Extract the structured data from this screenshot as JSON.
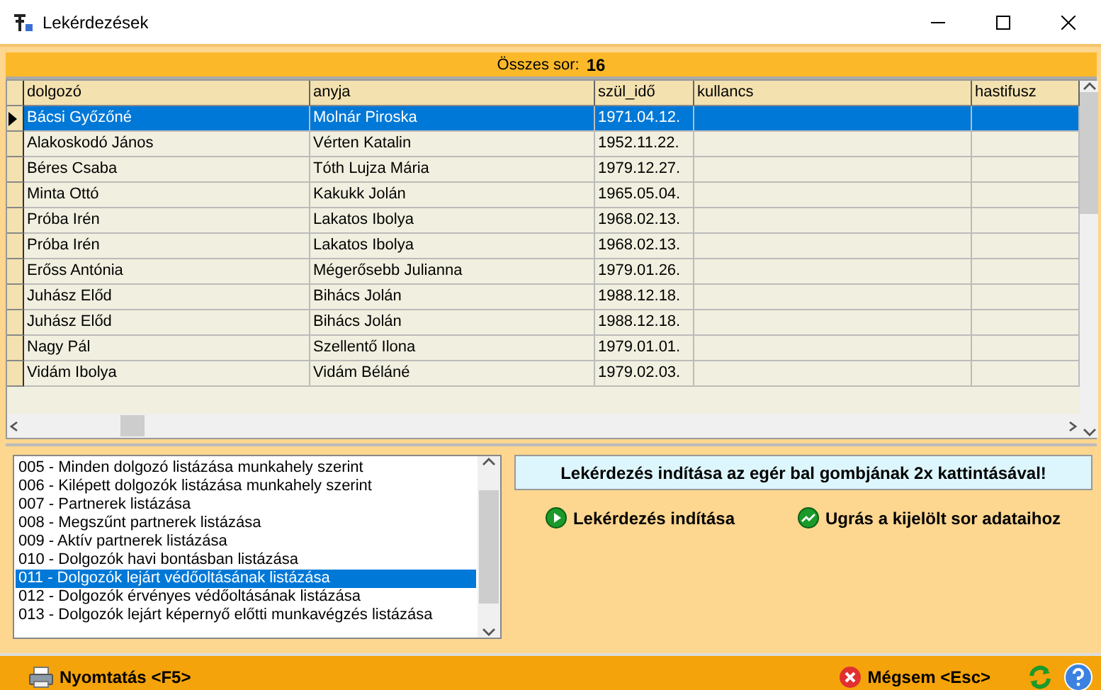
{
  "window": {
    "title": "Lekérdezések"
  },
  "summary": {
    "label": "Összes sor:",
    "value": "16"
  },
  "table": {
    "columns": [
      "dolgozó",
      "anyja",
      "szül_idő",
      "kullancs",
      "hastifusz"
    ],
    "rows": [
      {
        "cells": [
          "Bácsi Győzőné",
          "Molnár Piroska",
          "1971.04.12.",
          "",
          ""
        ],
        "selected": true
      },
      {
        "cells": [
          "Alakoskodó János",
          "Vérten Katalin",
          "1952.11.22.",
          "",
          ""
        ],
        "selected": false
      },
      {
        "cells": [
          "Béres Csaba",
          "Tóth Lujza Mária",
          "1979.12.27.",
          "",
          ""
        ],
        "selected": false
      },
      {
        "cells": [
          "Minta Ottó",
          "Kakukk Jolán",
          "1965.05.04.",
          "",
          ""
        ],
        "selected": false
      },
      {
        "cells": [
          "Próba Irén",
          "Lakatos Ibolya",
          "1968.02.13.",
          "",
          ""
        ],
        "selected": false
      },
      {
        "cells": [
          "Próba Irén",
          "Lakatos Ibolya",
          "1968.02.13.",
          "",
          ""
        ],
        "selected": false
      },
      {
        "cells": [
          "Erőss Antónia",
          "Mégerősebb Julianna",
          "1979.01.26.",
          "",
          ""
        ],
        "selected": false
      },
      {
        "cells": [
          "Juhász Előd",
          "Bihács Jolán",
          "1988.12.18.",
          "",
          ""
        ],
        "selected": false
      },
      {
        "cells": [
          "Juhász Előd",
          "Bihács Jolán",
          "1988.12.18.",
          "",
          ""
        ],
        "selected": false
      },
      {
        "cells": [
          "Nagy Pál",
          "Szellentő Ilona",
          "1979.01.01.",
          "",
          ""
        ],
        "selected": false
      },
      {
        "cells": [
          "Vidám Ibolya",
          "Vidám Béláné",
          "1979.02.03.",
          "",
          ""
        ],
        "selected": false
      }
    ]
  },
  "queries": [
    {
      "label": "005 - Minden dolgozó listázása munkahely szerint",
      "selected": false
    },
    {
      "label": "006 - Kilépett dolgozók listázása munkahely szerint",
      "selected": false
    },
    {
      "label": "007 - Partnerek listázása",
      "selected": false
    },
    {
      "label": "008 - Megszűnt partnerek listázása",
      "selected": false
    },
    {
      "label": "009 - Aktív partnerek listázása",
      "selected": false
    },
    {
      "label": "010 - Dolgozók havi bontásban listázása",
      "selected": false
    },
    {
      "label": "011 - Dolgozók lejárt védőoltásának listázása",
      "selected": true
    },
    {
      "label": "012 - Dolgozók érvényes védőoltásának listázása",
      "selected": false
    },
    {
      "label": "013 - Dolgozók lejárt képernyő előtti munkavégzés listázása",
      "selected": false
    }
  ],
  "hint": "Lekérdezés indítása az egér bal gombjának 2x kattintásával!",
  "actions": [
    {
      "kind": "run",
      "label": "Lekérdezés indítása"
    },
    {
      "kind": "jump",
      "label": "Ugrás a kijelölt sor adataihoz"
    }
  ],
  "footer": {
    "print": "Nyomtatás <F5>",
    "cancel": "Mégsem <Esc>"
  }
}
